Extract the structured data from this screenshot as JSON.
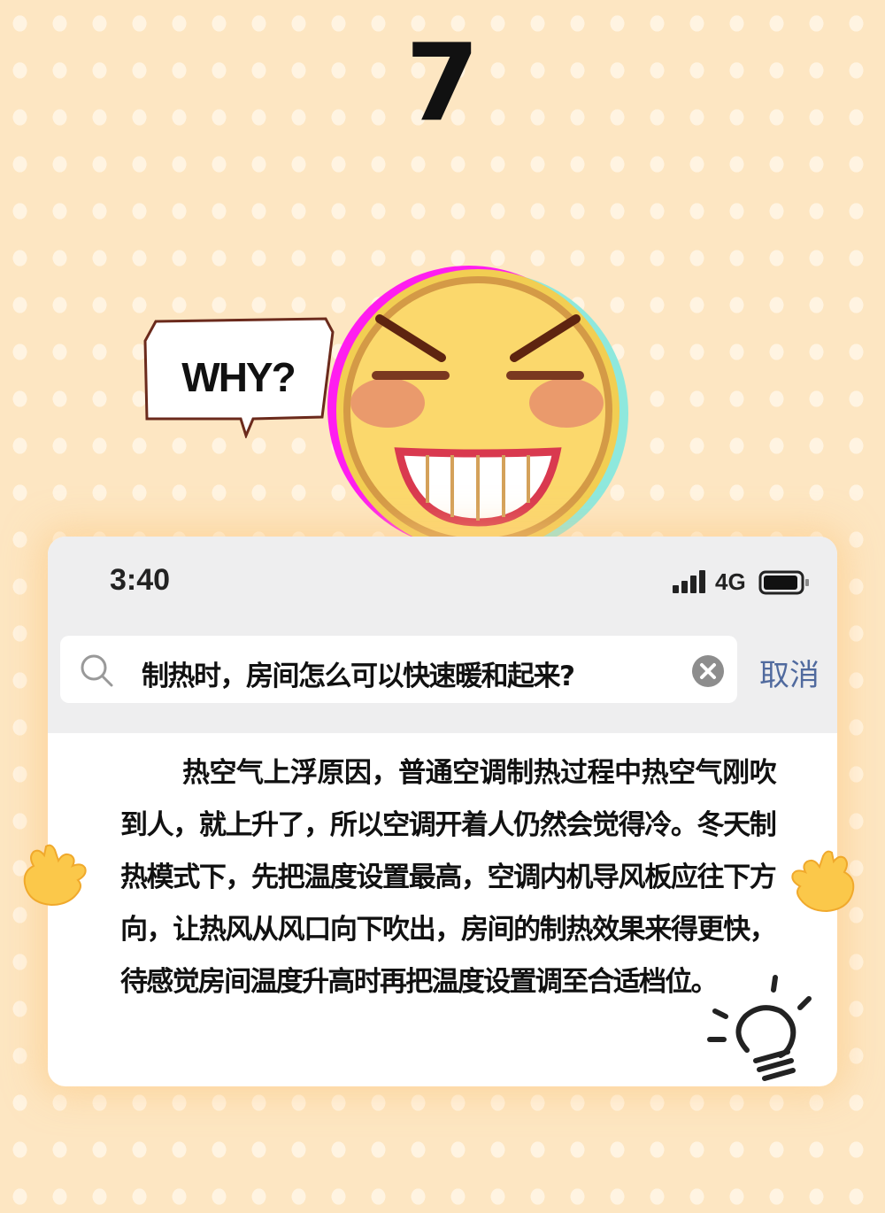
{
  "page_number": "7",
  "speech_bubble": {
    "text": "WHY?"
  },
  "status_bar": {
    "time": "3:40",
    "network": "4G"
  },
  "search": {
    "query": "制热时，房间怎么可以快速暖和起来?",
    "cancel_label": "取消"
  },
  "answer": {
    "text": "热空气上浮原因，普通空调制热过程中热空气刚吹到人，就上升了，所以空调开着人仍然会觉得冷。冬天制热模式下，先把温度设置最高，空调内机导风板应往下方向，让热风从风口向下吹出，房间的制热效果来得更快，待感觉房间温度升高时再把温度设置调至合适档位。"
  },
  "icons": [
    "grinning-emoji-icon",
    "speech-bubble-icon",
    "signal-icon",
    "battery-icon",
    "search-icon",
    "clear-icon",
    "hand-left-icon",
    "hand-right-icon",
    "lightbulb-icon"
  ],
  "colors": {
    "background": "#fde6c2",
    "cancel": "#506a9e",
    "emoji_face": "#fbd86c"
  }
}
